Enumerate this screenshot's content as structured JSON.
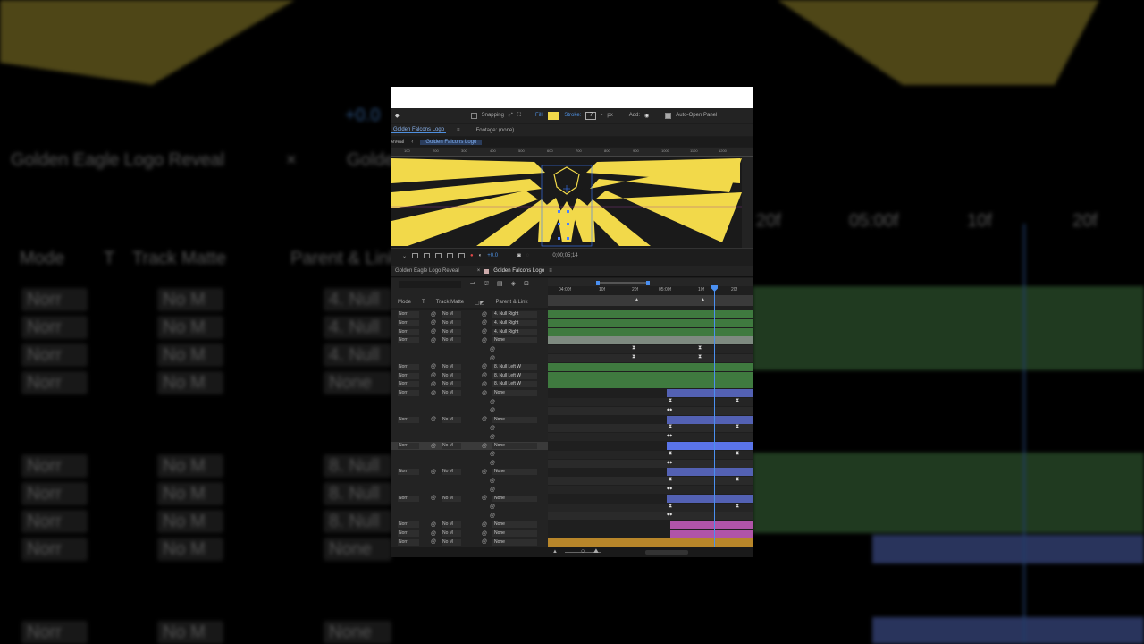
{
  "background": {
    "comp_title": "Golden Eagle Logo Reveal",
    "comp_tab2": "Golde",
    "col_mode": "Mode",
    "col_t": "T",
    "col_track_matte": "Track Matte",
    "col_parent": "Parent & Link",
    "offset": "+0.0",
    "ticks": [
      "20f",
      "05:00f",
      "10f",
      "20f"
    ],
    "rows": [
      {
        "mode": "Norr",
        "matte": "No M",
        "parent": "4. Null"
      },
      {
        "mode": "Norr",
        "matte": "No M",
        "parent": "4. Null"
      },
      {
        "mode": "Norr",
        "matte": "No M",
        "parent": "4. Null"
      },
      {
        "mode": "Norr",
        "matte": "No M",
        "parent": "None"
      },
      {
        "mode": "Norr",
        "matte": "No M",
        "parent": "8. Null"
      },
      {
        "mode": "Norr",
        "matte": "No M",
        "parent": "8. Null"
      },
      {
        "mode": "Norr",
        "matte": "No M",
        "parent": "8. Null"
      },
      {
        "mode": "Norr",
        "matte": "No M",
        "parent": "None"
      },
      {
        "mode": "Norr",
        "matte": "No M",
        "parent": "None"
      }
    ]
  },
  "toolbar": {
    "snapping": "Snapping",
    "fill": "Fill:",
    "stroke": "Stroke:",
    "stroke_value": "7",
    "stroke_unit": "px",
    "add": "Add:",
    "auto_open": "Auto-Open Panel",
    "fill_color": "#f2d94a"
  },
  "panels": {
    "comp_tab": "Golden Falcons Logo",
    "footage": "Footage: (none)",
    "crumb_prev": "eveal",
    "crumb_active": "Golden Falcons Logo"
  },
  "ruler_ticks": [
    "100",
    "200",
    "300",
    "400",
    "500",
    "600",
    "700",
    "800",
    "900",
    "1000",
    "1100",
    "1200"
  ],
  "viewer": {
    "offset": "+0.0",
    "timecode": "0;00;05;14",
    "logo_color": "#f2d94a"
  },
  "timeline": {
    "tab1": "Golden Eagle Logo Reveal",
    "tab2": "Golden Falcons Logo",
    "col_mode": "Mode",
    "col_t": "T",
    "col_track_matte": "Track Matte",
    "col_parent": "Parent & Link",
    "ticks": [
      "04:00f",
      "10f",
      "20f",
      "05:00f",
      "10f",
      "20f"
    ],
    "rows": [
      {
        "mode": "Norr",
        "matte": "No M",
        "parent": "4. Null Right"
      },
      {
        "mode": "Norr",
        "matte": "No M",
        "parent": "4. Null Right"
      },
      {
        "mode": "Norr",
        "matte": "No M",
        "parent": "4. Null Right"
      },
      {
        "mode": "Norr",
        "matte": "No M",
        "parent": "None"
      },
      {
        "mode": "",
        "matte": "",
        "parent": ""
      },
      {
        "mode": "",
        "matte": "",
        "parent": ""
      },
      {
        "mode": "Norr",
        "matte": "No M",
        "parent": "8. Null Left W"
      },
      {
        "mode": "Norr",
        "matte": "No M",
        "parent": "8. Null Left W"
      },
      {
        "mode": "Norr",
        "matte": "No M",
        "parent": "8. Null Left W"
      },
      {
        "mode": "Norr",
        "matte": "No M",
        "parent": "None"
      },
      {
        "mode": "",
        "matte": "",
        "parent": ""
      },
      {
        "mode": "",
        "matte": "",
        "parent": ""
      },
      {
        "mode": "Norr",
        "matte": "No M",
        "parent": "None"
      },
      {
        "mode": "",
        "matte": "",
        "parent": ""
      },
      {
        "mode": "",
        "matte": "",
        "parent": ""
      },
      {
        "mode": "Norr",
        "matte": "No M",
        "parent": "None"
      },
      {
        "mode": "",
        "matte": "",
        "parent": ""
      },
      {
        "mode": "",
        "matte": "",
        "parent": ""
      },
      {
        "mode": "Norr",
        "matte": "No M",
        "parent": "None"
      },
      {
        "mode": "",
        "matte": "",
        "parent": ""
      },
      {
        "mode": "",
        "matte": "",
        "parent": ""
      },
      {
        "mode": "Norr",
        "matte": "No M",
        "parent": "None"
      },
      {
        "mode": "",
        "matte": "",
        "parent": ""
      },
      {
        "mode": "",
        "matte": "",
        "parent": ""
      },
      {
        "mode": "Norr",
        "matte": "No M",
        "parent": "None"
      },
      {
        "mode": "Norr",
        "matte": "No M",
        "parent": "None"
      },
      {
        "mode": "Norr",
        "matte": "No M",
        "parent": "None"
      }
    ],
    "colors": {
      "green": "#3f7a3f",
      "gray": "#7e8a80",
      "blue": "#5361b3",
      "pink": "#b054a8",
      "orange": "#b8862a",
      "playhead": "#4a8ff0"
    }
  }
}
